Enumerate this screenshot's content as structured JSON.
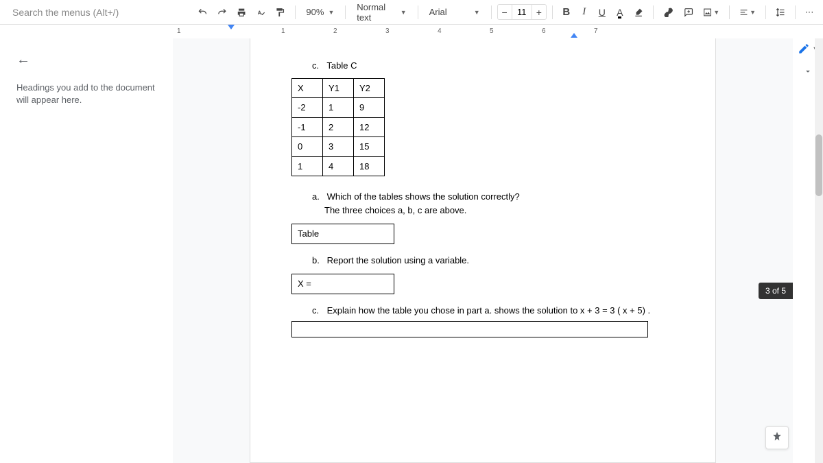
{
  "toolbar": {
    "search_placeholder": "Search the menus (Alt+/)",
    "zoom": "90%",
    "style": "Normal text",
    "font": "Arial",
    "font_size": "11",
    "minus": "−",
    "plus": "+",
    "bold": "B",
    "italic": "I",
    "underline": "U",
    "textcolor": "A",
    "more": "⋯"
  },
  "ruler": {
    "nums": [
      "1",
      "1",
      "2",
      "3",
      "4",
      "5",
      "6",
      "7"
    ]
  },
  "sidebar": {
    "hint": "Headings you add to the document will appear here."
  },
  "doc": {
    "tableC": {
      "label": "c.",
      "title": "Table C",
      "rows": [
        [
          "X",
          "Y1",
          "Y2"
        ],
        [
          "-2",
          "1",
          "9"
        ],
        [
          "-1",
          "2",
          "12"
        ],
        [
          "0",
          "3",
          "15"
        ],
        [
          "1",
          "4",
          "18"
        ]
      ]
    },
    "qA": {
      "label": "a.",
      "text1": "Which of the tables shows the solution correctly?",
      "text2": "The three choices a, b, c  are above.",
      "answer": "Table"
    },
    "qB": {
      "label": "b.",
      "text": "Report the solution using a variable.",
      "answer": "X ="
    },
    "qC": {
      "label": "c.",
      "text": "Explain how the table you chose in part a. shows the solution to x + 3 = 3 ( x + 5) .",
      "answer": ""
    }
  },
  "page_indicator": "3 of 5"
}
